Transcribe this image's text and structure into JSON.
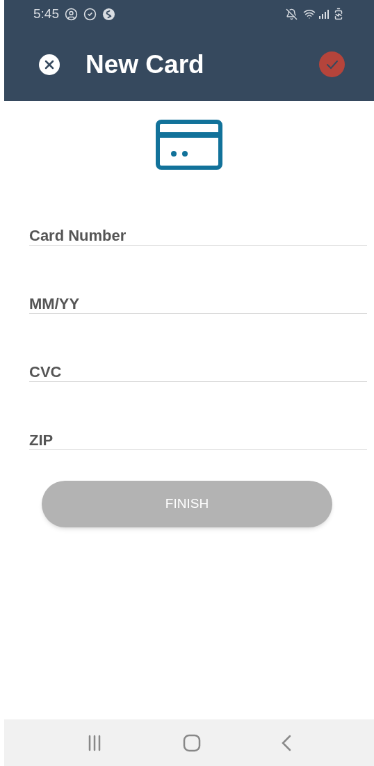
{
  "status_bar": {
    "time": "5:45"
  },
  "header": {
    "title": "New Card"
  },
  "fields": [
    {
      "placeholder": "Card Number"
    },
    {
      "placeholder": "MM/YY"
    },
    {
      "placeholder": "CVC"
    },
    {
      "placeholder": "ZIP"
    }
  ],
  "finish_button": {
    "label": "FINISH",
    "disabled": true
  }
}
